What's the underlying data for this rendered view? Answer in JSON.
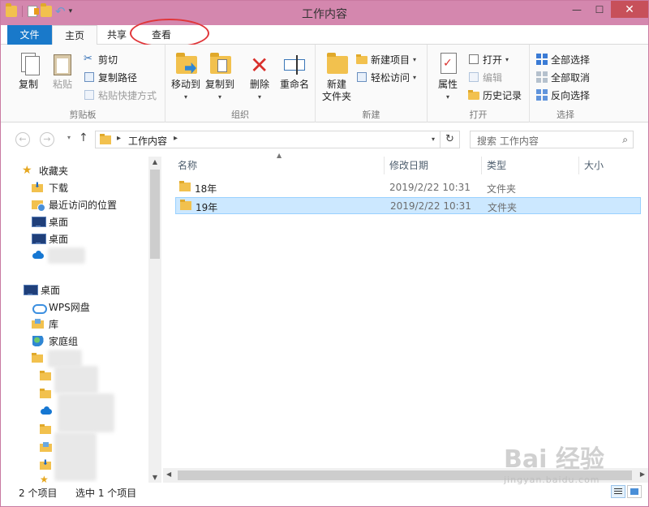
{
  "window": {
    "title": "工作内容",
    "minimize": "—",
    "maximize": "☐",
    "close": "✕"
  },
  "ribbon_tabs": {
    "file": "文件",
    "home": "主页",
    "share": "共享",
    "view": "查看"
  },
  "ribbon": {
    "clipboard": {
      "label": "剪贴板",
      "copy": "复制",
      "paste": "粘贴",
      "cut": "剪切",
      "copy_path": "复制路径",
      "paste_shortcut": "粘贴快捷方式"
    },
    "organize": {
      "label": "组织",
      "move_to": "移动到",
      "copy_to": "复制到",
      "delete": "删除",
      "rename": "重命名"
    },
    "new": {
      "label": "新建",
      "new_folder": "新建\n文件夹",
      "new_item": "新建项目",
      "easy_access": "轻松访问"
    },
    "open": {
      "label": "打开",
      "properties": "属性",
      "open": "打开",
      "edit": "编辑",
      "history": "历史记录"
    },
    "select": {
      "label": "选择",
      "select_all": "全部选择",
      "select_none": "全部取消",
      "invert": "反向选择"
    }
  },
  "address": {
    "path": "工作内容",
    "search_placeholder": "搜索 工作内容"
  },
  "nav_pane": {
    "favorites": "收藏夹",
    "downloads": "下载",
    "recent": "最近访问的位置",
    "desktop1": "桌面",
    "desktop2": "桌面",
    "desktop_root": "桌面",
    "wps": "WPS网盘",
    "library": "库",
    "homegroup": "家庭组"
  },
  "columns": {
    "name": "名称",
    "date": "修改日期",
    "type": "类型",
    "size": "大小"
  },
  "files": [
    {
      "name": "18年",
      "date": "2019/2/22 10:31",
      "type": "文件夹",
      "selected": false
    },
    {
      "name": "19年",
      "date": "2019/2/22 10:31",
      "type": "文件夹",
      "selected": true
    }
  ],
  "status": {
    "count": "2 个项目",
    "selected": "选中 1 个项目"
  },
  "colors": {
    "titlebar": "#d487ae",
    "file_tab": "#1979ca",
    "selection": "#cce8ff",
    "annotation": "#e0363a"
  },
  "watermark": {
    "main": "Bai 经验",
    "sub": "jingyan.baidu.com"
  }
}
